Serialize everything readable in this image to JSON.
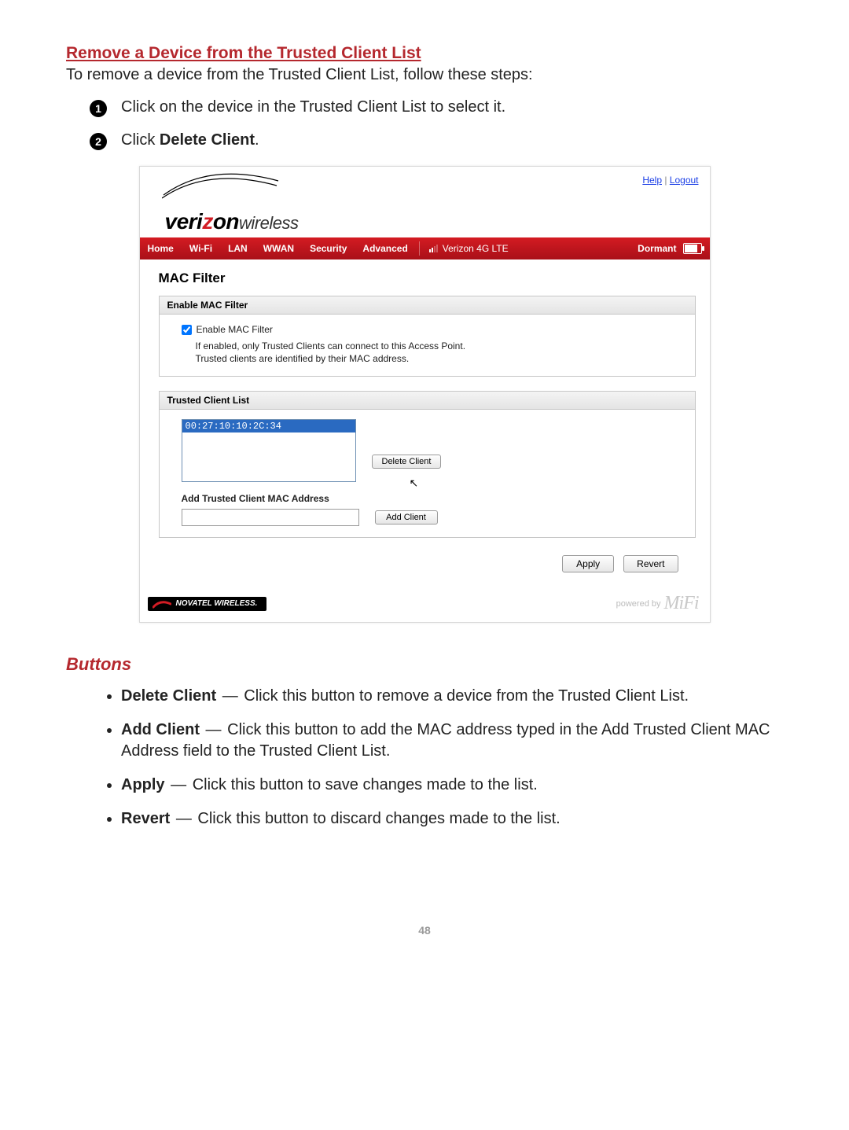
{
  "section": {
    "title": "Remove a Device from the Trusted Client List",
    "subtitle": "To remove a device from the Trusted Client List, follow these steps:",
    "steps": [
      {
        "num": "1",
        "pre": "Click on the device in the Trusted Client List to select it."
      },
      {
        "num": "2",
        "pre": "Click ",
        "bold": "Delete Client",
        "post": "."
      }
    ]
  },
  "shot": {
    "toplinks": {
      "help": "Help",
      "logout": "Logout"
    },
    "brand": {
      "veri": "veri",
      "z": "z",
      "on": "on",
      "wireless": "wireless"
    },
    "nav": {
      "items": [
        "Home",
        "Wi-Fi",
        "LAN",
        "WWAN",
        "Security",
        "Advanced"
      ],
      "carrier": "Verizon  4G LTE",
      "state": "Dormant"
    },
    "page_title": "MAC Filter",
    "panel1": {
      "header": "Enable MAC Filter",
      "checkbox_label": "Enable MAC Filter",
      "note1": "If enabled, only Trusted Clients can connect to this Access Point.",
      "note2": "Trusted clients are identified by their MAC address."
    },
    "panel2": {
      "header": "Trusted Client List",
      "selected_mac": "00:27:10:10:2C:34",
      "delete_btn": "Delete Client",
      "add_header": "Add Trusted Client MAC Address",
      "add_btn": "Add Client"
    },
    "actions": {
      "apply": "Apply",
      "revert": "Revert"
    },
    "footer": {
      "novatel": "NOVATEL WIRELESS.",
      "powered": "powered by",
      "mifi": "MiFi"
    }
  },
  "buttons_section": {
    "title": "Buttons",
    "items": [
      {
        "name": "Delete Client",
        "desc": "Click this button to remove a device from the Trusted Client List."
      },
      {
        "name": "Add Client",
        "desc": "Click this button to add the MAC address typed in the Add Trusted Client MAC Address field to the Trusted Client List."
      },
      {
        "name": "Apply",
        "desc": "Click this button to save changes made to the list."
      },
      {
        "name": "Revert",
        "desc": "Click this button to discard changes made to the list."
      }
    ]
  },
  "page_number": "48"
}
